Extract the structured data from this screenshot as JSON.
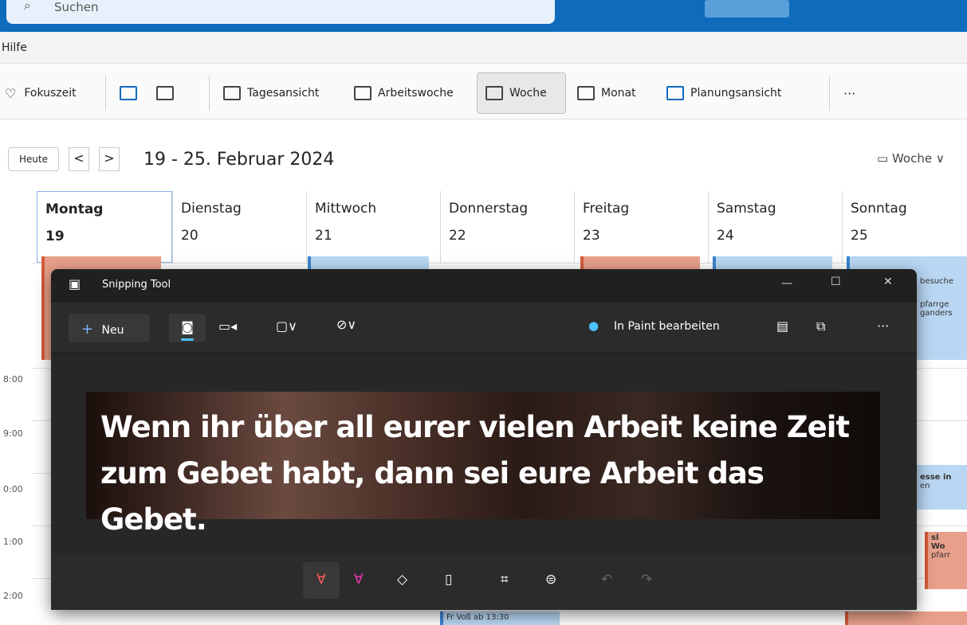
{
  "outlook": {
    "search_placeholder": "Suchen",
    "menu": {
      "help": "Hilfe"
    },
    "ribbon": {
      "focus": "Fokuszeit",
      "day": "Tagesansicht",
      "workweek": "Arbeitswoche",
      "week": "Woche",
      "month": "Monat",
      "schedule": "Planungsansicht",
      "more": "···"
    },
    "nav": {
      "today": "Heute",
      "prev": "<",
      "next": ">",
      "range": "19 - 25. Februar 2024",
      "view_select": "Woche"
    },
    "days": [
      {
        "name": "Montag",
        "num": "19"
      },
      {
        "name": "Dienstag",
        "num": "20"
      },
      {
        "name": "Mittwoch",
        "num": "21"
      },
      {
        "name": "Donnerstag",
        "num": "22"
      },
      {
        "name": "Freitag",
        "num": "23"
      },
      {
        "name": "Samstag",
        "num": "24"
      },
      {
        "name": "Sonntag",
        "num": "25"
      }
    ],
    "times": [
      "8:00",
      "9:00",
      "0:00",
      "1:00",
      "2:00"
    ],
    "events": {
      "sun1": "besuche",
      "sun2": "pfarrge",
      "sun3": "ganders",
      "sun_mass": "esse in",
      "sun_mass2": "en",
      "sun_wo1": "sl",
      "sun_wo2": "Wo",
      "sun_wo3": "pfarr",
      "thu_bottom": "Fr Voß ab 13:30"
    }
  },
  "snipping": {
    "title": "Snipping Tool",
    "new_label": "Neu",
    "paint_label": "In Paint bearbeiten",
    "minimize": "—",
    "maximize": "☐",
    "close": "✕",
    "more": "···",
    "quote_line1": "Wenn ihr über all eurer vielen Arbeit keine Zeit",
    "quote_line2": "zum Gebet habt, dann sei eure Arbeit das Gebet."
  },
  "colors": {
    "accent": "#0f6cbd",
    "event_orange": "#e8a08a",
    "event_blue": "#b9d7f3"
  }
}
